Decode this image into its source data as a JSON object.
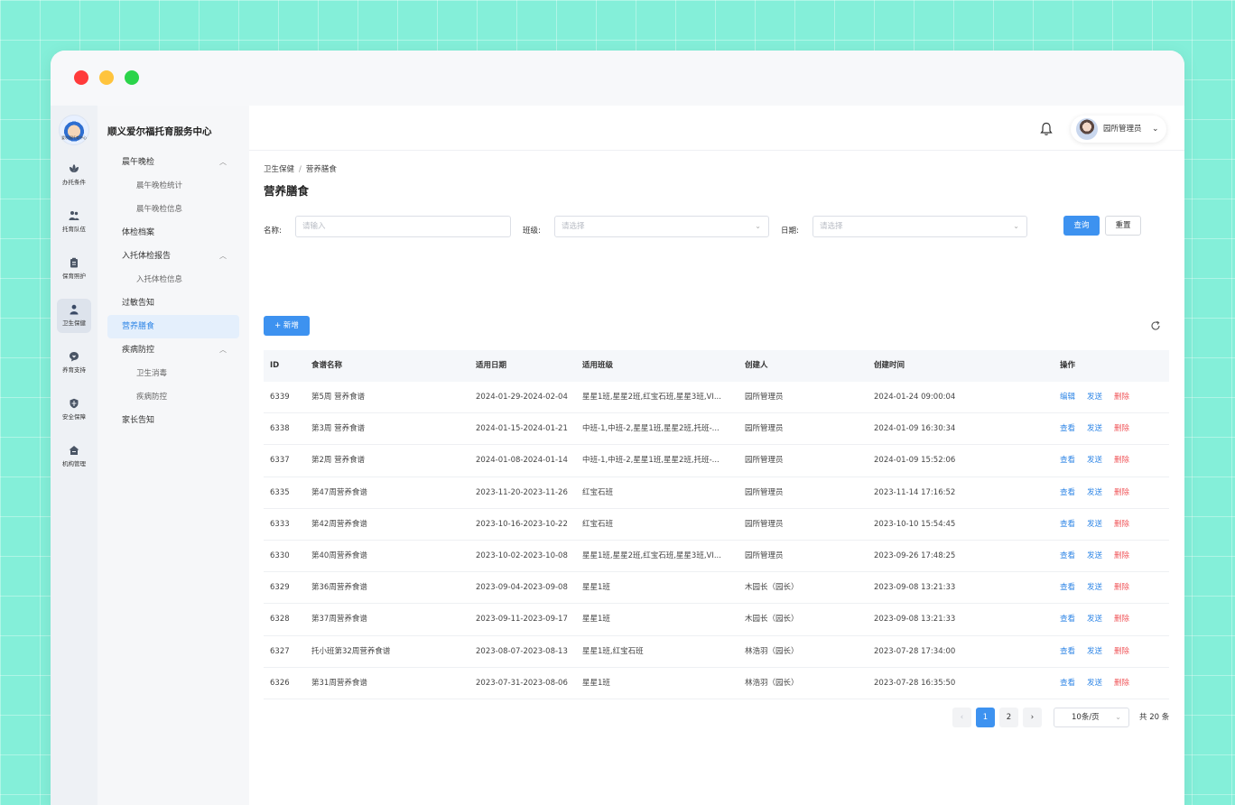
{
  "sidebar_rail": {
    "logo_text": "爱尔福托育中心",
    "items": [
      {
        "label": "办托条件",
        "icon": "lotus-icon"
      },
      {
        "label": "托育队伍",
        "icon": "team-icon"
      },
      {
        "label": "保育照护",
        "icon": "clipboard-icon"
      },
      {
        "label": "卫生保健",
        "icon": "staff-icon"
      },
      {
        "label": "养育支持",
        "icon": "chat-heart-icon"
      },
      {
        "label": "安全保障",
        "icon": "shield-icon"
      },
      {
        "label": "机构管理",
        "icon": "house-icon"
      }
    ]
  },
  "menu": {
    "title": "顺义爱尔福托育服务中心",
    "items": [
      {
        "label": "晨午晚检",
        "expandable": true
      },
      {
        "label": "晨午晚检统计",
        "sub": true
      },
      {
        "label": "晨午晚检信息",
        "sub": true
      },
      {
        "label": "体检档案"
      },
      {
        "label": "入托体检报告",
        "expandable": true
      },
      {
        "label": "入托体检信息",
        "sub": true
      },
      {
        "label": "过敏告知"
      },
      {
        "label": "营养膳食",
        "active": true
      },
      {
        "label": "疾病防控",
        "expandable": true
      },
      {
        "label": "卫生消毒",
        "sub": true
      },
      {
        "label": "疾病防控",
        "sub": true
      },
      {
        "label": "家长告知"
      }
    ]
  },
  "header": {
    "user_name": "园所管理员"
  },
  "breadcrumb": {
    "parent": "卫生保健",
    "separator": "/",
    "current": "营养膳食"
  },
  "page_title": "营养膳食",
  "filters": {
    "name_label": "名称:",
    "name_placeholder": "请输入",
    "class_label": "班级:",
    "class_placeholder": "请选择",
    "date_label": "日期:",
    "date_placeholder": "请选择",
    "search_label": "查询",
    "reset_label": "重置"
  },
  "toolbar": {
    "add_label": "+ 新增"
  },
  "table": {
    "headers": [
      "ID",
      "食谱名称",
      "适用日期",
      "适用班级",
      "创建人",
      "创建时间",
      "操作"
    ],
    "rows": [
      {
        "id": "6339",
        "name": "第5周 营养食谱",
        "date": "2024-01-29-2024-02-04",
        "classes": "星星1班,星星2班,红宝石班,星星3班,VI...",
        "creator": "园所管理员",
        "created": "2024-01-24 09:00:04",
        "actions": [
          "编辑",
          "发送",
          "删除"
        ]
      },
      {
        "id": "6338",
        "name": "第3周 营养食谱",
        "date": "2024-01-15-2024-01-21",
        "classes": "中班-1,中班-2,星星1班,星星2班,托班-...",
        "creator": "园所管理员",
        "created": "2024-01-09 16:30:34",
        "actions": [
          "查看",
          "发送",
          "删除"
        ]
      },
      {
        "id": "6337",
        "name": "第2周 营养食谱",
        "date": "2024-01-08-2024-01-14",
        "classes": "中班-1,中班-2,星星1班,星星2班,托班-...",
        "creator": "园所管理员",
        "created": "2024-01-09 15:52:06",
        "actions": [
          "查看",
          "发送",
          "删除"
        ]
      },
      {
        "id": "6335",
        "name": "第47周营养食谱",
        "date": "2023-11-20-2023-11-26",
        "classes": "红宝石班",
        "creator": "园所管理员",
        "created": "2023-11-14 17:16:52",
        "actions": [
          "查看",
          "发送",
          "删除"
        ]
      },
      {
        "id": "6333",
        "name": "第42周营养食谱",
        "date": "2023-10-16-2023-10-22",
        "classes": "红宝石班",
        "creator": "园所管理员",
        "created": "2023-10-10 15:54:45",
        "actions": [
          "查看",
          "发送",
          "删除"
        ]
      },
      {
        "id": "6330",
        "name": "第40周营养食谱",
        "date": "2023-10-02-2023-10-08",
        "classes": "星星1班,星星2班,红宝石班,星星3班,VI...",
        "creator": "园所管理员",
        "created": "2023-09-26 17:48:25",
        "actions": [
          "查看",
          "发送",
          "删除"
        ]
      },
      {
        "id": "6329",
        "name": "第36周营养食谱",
        "date": "2023-09-04-2023-09-08",
        "classes": "星星1班",
        "creator": "木园长（园长）",
        "created": "2023-09-08 13:21:33",
        "actions": [
          "查看",
          "发送",
          "删除"
        ]
      },
      {
        "id": "6328",
        "name": "第37周营养食谱",
        "date": "2023-09-11-2023-09-17",
        "classes": "星星1班",
        "creator": "木园长（园长）",
        "created": "2023-09-08 13:21:33",
        "actions": [
          "查看",
          "发送",
          "删除"
        ]
      },
      {
        "id": "6327",
        "name": "托小班第32周营养食谱",
        "date": "2023-08-07-2023-08-13",
        "classes": "星星1班,红宝石班",
        "creator": "林浩羽（园长）",
        "created": "2023-07-28 17:34:00",
        "actions": [
          "查看",
          "发送",
          "删除"
        ]
      },
      {
        "id": "6326",
        "name": "第31周营养食谱",
        "date": "2023-07-31-2023-08-06",
        "classes": "星星1班",
        "creator": "林浩羽（园长）",
        "created": "2023-07-28 16:35:50",
        "actions": [
          "查看",
          "发送",
          "删除"
        ]
      }
    ]
  },
  "pagination": {
    "prev": "‹",
    "pages": [
      "1",
      "2"
    ],
    "current": "1",
    "next": "›",
    "page_size": "10条/页",
    "total": "共 20 条"
  },
  "colors": {
    "accent": "#3d92f0",
    "danger": "#f0565a",
    "background": "#84efd9"
  }
}
